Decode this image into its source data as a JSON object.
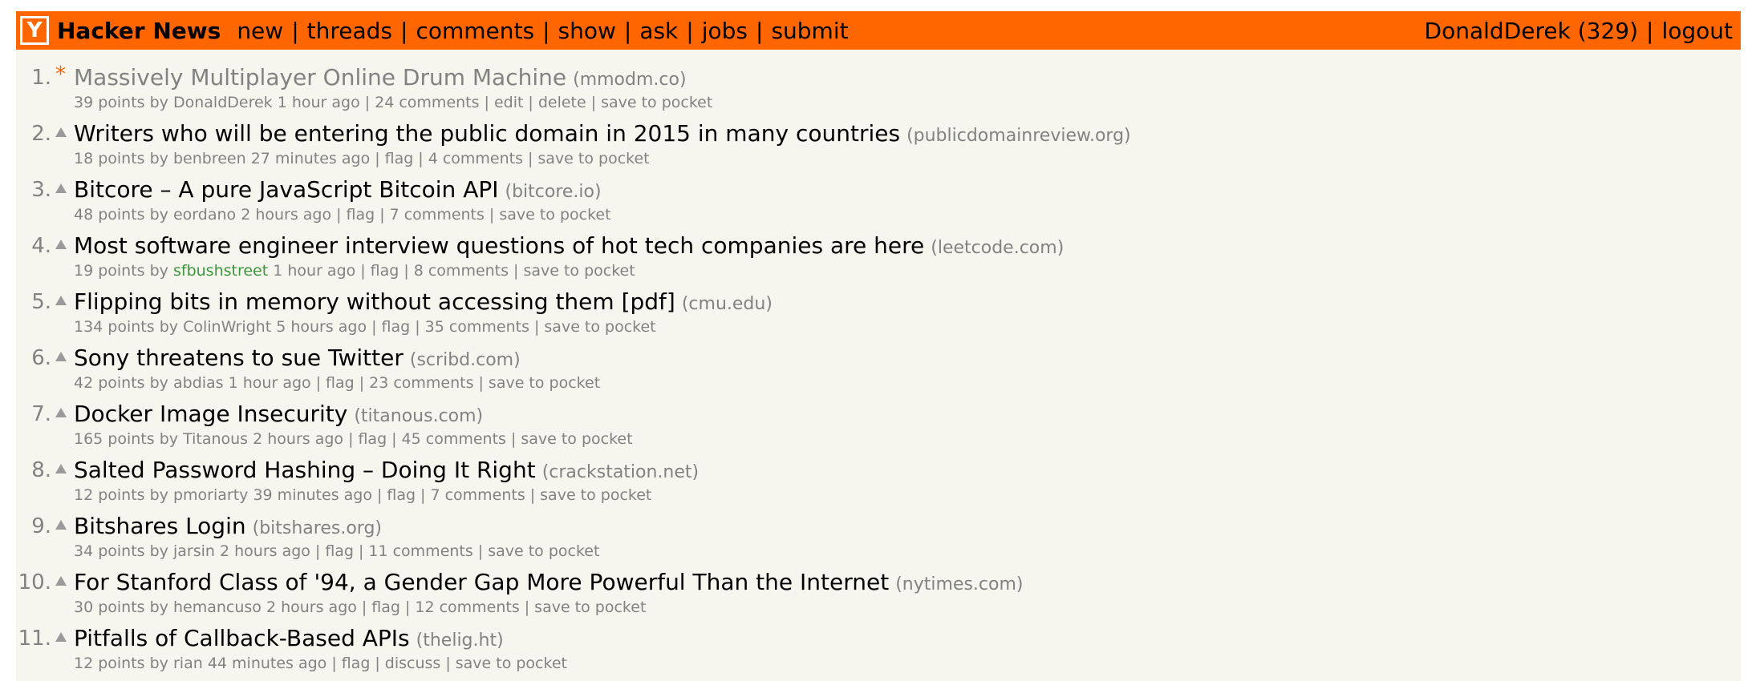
{
  "header": {
    "logo_letter": "Y",
    "site_title": "Hacker News",
    "nav": [
      "new",
      "threads",
      "comments",
      "show",
      "ask",
      "jobs",
      "submit"
    ],
    "user": "DonaldDerek (329)",
    "logout": "logout",
    "colors": {
      "bar": "#ff6600",
      "page_bg": "#f6f6ef",
      "muted": "#828282",
      "new_user": "#3c963c"
    }
  },
  "stories": [
    {
      "rank": "1.",
      "marker": "star",
      "star": "*",
      "title": "Massively Multiplayer Online Drum Machine",
      "site": "(mmodm.co)",
      "visited": true,
      "meta": {
        "points": "39 points",
        "by": "by",
        "user": "DonaldDerek",
        "new_user": false,
        "age": "1 hour ago",
        "links": [
          "24 comments",
          "edit",
          "delete",
          "save to pocket"
        ]
      }
    },
    {
      "rank": "2.",
      "marker": "vote",
      "title": "Writers who will be entering the public domain in 2015 in many countries",
      "site": "(publicdomainreview.org)",
      "visited": false,
      "meta": {
        "points": "18 points",
        "by": "by",
        "user": "benbreen",
        "new_user": false,
        "age": "27 minutes ago",
        "links": [
          "flag",
          "4 comments",
          "save to pocket"
        ]
      }
    },
    {
      "rank": "3.",
      "marker": "vote",
      "title": "Bitcore – A pure JavaScript Bitcoin API",
      "site": "(bitcore.io)",
      "visited": false,
      "meta": {
        "points": "48 points",
        "by": "by",
        "user": "eordano",
        "new_user": false,
        "age": "2 hours ago",
        "links": [
          "flag",
          "7 comments",
          "save to pocket"
        ]
      }
    },
    {
      "rank": "4.",
      "marker": "vote",
      "title": "Most software engineer interview questions of hot tech companies are here",
      "site": "(leetcode.com)",
      "visited": false,
      "meta": {
        "points": "19 points",
        "by": "by",
        "user": "sfbushstreet",
        "new_user": true,
        "age": "1 hour ago",
        "links": [
          "flag",
          "8 comments",
          "save to pocket"
        ]
      }
    },
    {
      "rank": "5.",
      "marker": "vote",
      "title": "Flipping bits in memory without accessing them [pdf]",
      "site": "(cmu.edu)",
      "visited": false,
      "meta": {
        "points": "134 points",
        "by": "by",
        "user": "ColinWright",
        "new_user": false,
        "age": "5 hours ago",
        "links": [
          "flag",
          "35 comments",
          "save to pocket"
        ]
      }
    },
    {
      "rank": "6.",
      "marker": "vote",
      "title": "Sony threatens to sue Twitter",
      "site": "(scribd.com)",
      "visited": false,
      "meta": {
        "points": "42 points",
        "by": "by",
        "user": "abdias",
        "new_user": false,
        "age": "1 hour ago",
        "links": [
          "flag",
          "23 comments",
          "save to pocket"
        ]
      }
    },
    {
      "rank": "7.",
      "marker": "vote",
      "title": "Docker Image Insecurity",
      "site": "(titanous.com)",
      "visited": false,
      "meta": {
        "points": "165 points",
        "by": "by",
        "user": "Titanous",
        "new_user": false,
        "age": "2 hours ago",
        "links": [
          "flag",
          "45 comments",
          "save to pocket"
        ]
      }
    },
    {
      "rank": "8.",
      "marker": "vote",
      "title": "Salted Password Hashing – Doing It Right",
      "site": "(crackstation.net)",
      "visited": false,
      "meta": {
        "points": "12 points",
        "by": "by",
        "user": "pmoriarty",
        "new_user": false,
        "age": "39 minutes ago",
        "links": [
          "flag",
          "7 comments",
          "save to pocket"
        ]
      }
    },
    {
      "rank": "9.",
      "marker": "vote",
      "title": "Bitshares Login",
      "site": "(bitshares.org)",
      "visited": false,
      "meta": {
        "points": "34 points",
        "by": "by",
        "user": "jarsin",
        "new_user": false,
        "age": "2 hours ago",
        "links": [
          "flag",
          "11 comments",
          "save to pocket"
        ]
      }
    },
    {
      "rank": "10.",
      "marker": "vote",
      "title": "For Stanford Class of '94, a Gender Gap More Powerful Than the Internet",
      "site": "(nytimes.com)",
      "visited": false,
      "meta": {
        "points": "30 points",
        "by": "by",
        "user": "hemancuso",
        "new_user": false,
        "age": "2 hours ago",
        "links": [
          "flag",
          "12 comments",
          "save to pocket"
        ]
      }
    },
    {
      "rank": "11.",
      "marker": "vote",
      "title": "Pitfalls of Callback-Based APIs",
      "site": "(thelig.ht)",
      "visited": false,
      "meta": {
        "points": "12 points",
        "by": "by",
        "user": "rian",
        "new_user": false,
        "age": "44 minutes ago",
        "links": [
          "flag",
          "discuss",
          "save to pocket"
        ]
      }
    }
  ]
}
